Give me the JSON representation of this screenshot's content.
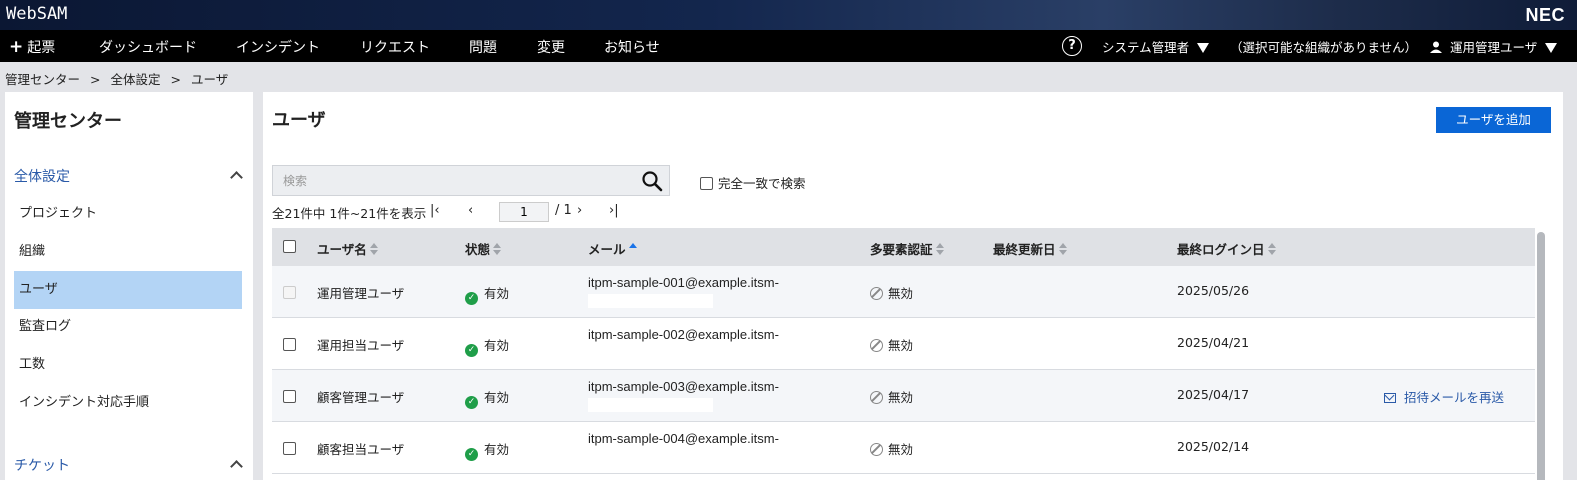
{
  "header": {
    "app_name": "WebSAM",
    "brand": "NEC"
  },
  "nav": {
    "create_label": "起票",
    "items": [
      "ダッシュボード",
      "インシデント",
      "リクエスト",
      "問題",
      "変更",
      "お知らせ"
    ],
    "role": "システム管理者",
    "org": "（選択可能な組織がありません）",
    "user": "運用管理ユーザ"
  },
  "breadcrumb": [
    "管理センター",
    "全体設定",
    "ユーザ"
  ],
  "breadcrumb_sep": ">",
  "sidebar": {
    "title": "管理センター",
    "sections": [
      {
        "label": "全体設定",
        "items": [
          "プロジェクト",
          "組織",
          "ユーザ",
          "監査ログ",
          "工数",
          "インシデント対応手順"
        ],
        "active": "ユーザ"
      },
      {
        "label": "チケット",
        "items": []
      }
    ]
  },
  "main": {
    "title": "ユーザ",
    "add_button": "ユーザを追加",
    "search_placeholder": "検索",
    "exact_match_label": "完全一致で検索",
    "pager": {
      "summary": "全21件中 1件~21件を表示",
      "current_page": "1",
      "total_pages": "/ 1"
    },
    "columns": [
      "ユーザ名",
      "状態",
      "メール",
      "多要素認証",
      "最終更新日",
      "最終ログイン日"
    ],
    "rows": [
      {
        "name": "運用管理ユーザ",
        "status": "有効",
        "email": "itpm-sample-001@example.itsm-",
        "mfa": "無効",
        "updated": "",
        "last_login": "2025/05/26",
        "action": ""
      },
      {
        "name": "運用担当ユーザ",
        "status": "有効",
        "email": "itpm-sample-002@example.itsm-",
        "mfa": "無効",
        "updated": "",
        "last_login": "2025/04/21",
        "action": ""
      },
      {
        "name": "顧客管理ユーザ",
        "status": "有効",
        "email": "itpm-sample-003@example.itsm-",
        "mfa": "無効",
        "updated": "",
        "last_login": "2025/04/17",
        "action": "招待メールを再送"
      },
      {
        "name": "顧客担当ユーザ",
        "status": "有効",
        "email": "itpm-sample-004@example.itsm-",
        "mfa": "無効",
        "updated": "",
        "last_login": "2025/02/14",
        "action": ""
      }
    ]
  }
}
